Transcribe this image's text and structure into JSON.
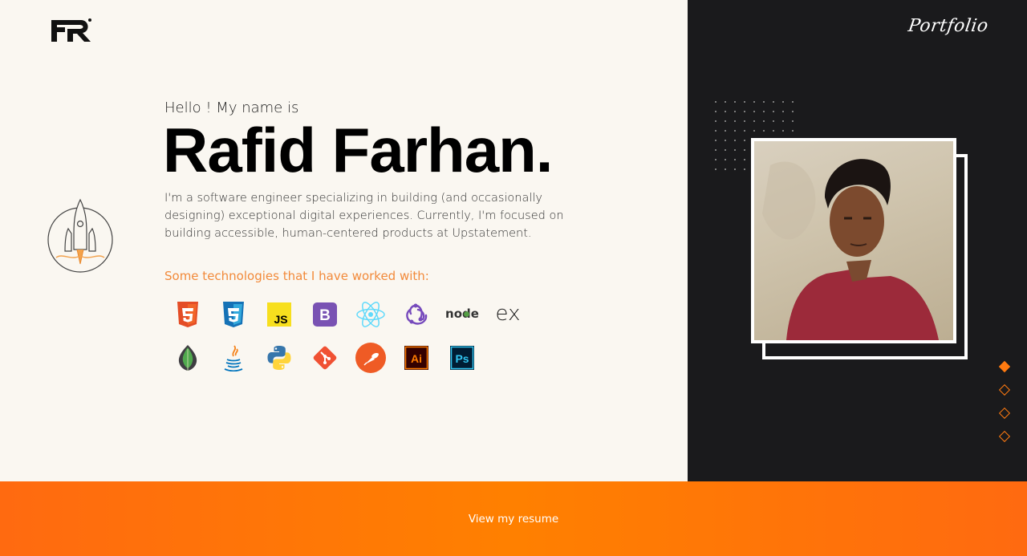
{
  "header": {
    "logo_text": "FR",
    "script_title": "Portfolio"
  },
  "hero": {
    "greeting": "Hello ! My name is",
    "name": "Rafid Farhan.",
    "bio": "I'm a software engineer specializing in building (and occasionally designing) exceptional digital experiences. Currently, I'm focused on building accessible, human-centered products at Upstatement.",
    "tech_title": "Some technologies that I have worked with:"
  },
  "technologies": {
    "row1": [
      "html5-icon",
      "css3-icon",
      "javascript-icon",
      "bootstrap-icon",
      "react-icon",
      "redux-icon",
      "nodejs-icon",
      "express-icon"
    ],
    "row2": [
      "mongodb-icon",
      "java-icon",
      "python-icon",
      "git-icon",
      "postman-icon",
      "illustrator-icon",
      "photoshop-icon"
    ],
    "labels": {
      "javascript": "JS",
      "bootstrap": "B",
      "nodejs": "node",
      "express": "ex",
      "illustrator": "Ai",
      "photoshop": "Ps"
    }
  },
  "nav": {
    "dots": 4,
    "active_index": 0
  },
  "footer": {
    "resume_label": "View my resume"
  },
  "colors": {
    "accent": "#ff7a10",
    "dark_panel": "#1a1a1c",
    "light_panel": "#faf7f1",
    "tech_title": "#f28a3a"
  }
}
